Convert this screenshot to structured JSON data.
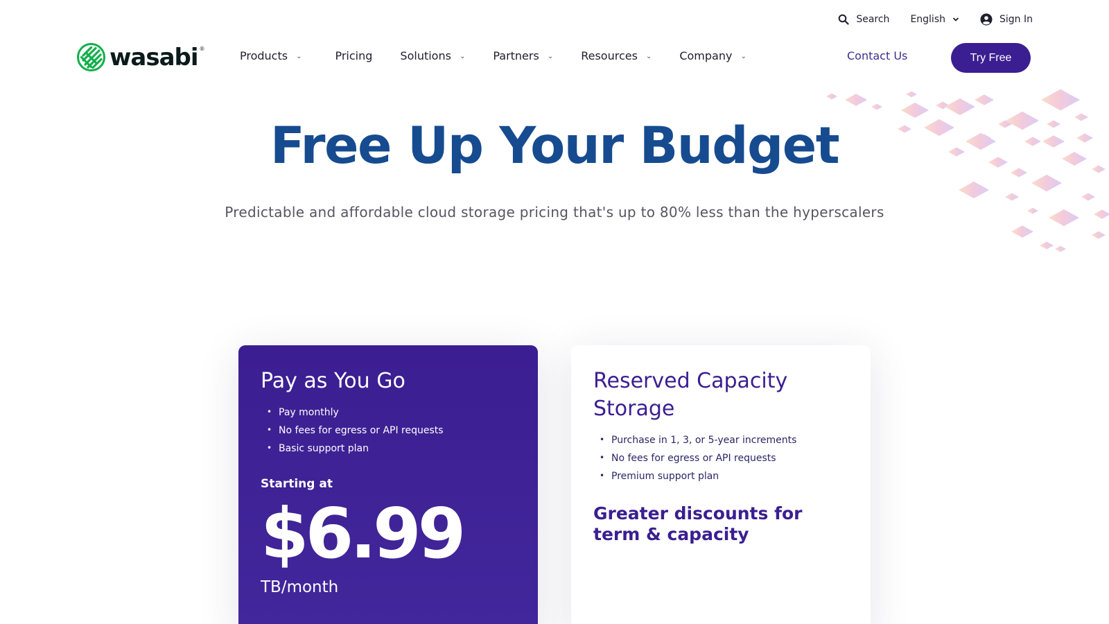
{
  "utility": {
    "search_label": "Search",
    "language_label": "English",
    "signin_label": "Sign In"
  },
  "brand": {
    "name": "wasabi",
    "reg_mark": "®",
    "colors": {
      "logo_green": "#12b04b",
      "accent_purple": "#3b1e91",
      "title_blue": "#164b8f"
    }
  },
  "nav": {
    "items": [
      {
        "label": "Products",
        "has_dropdown": true
      },
      {
        "label": "Pricing",
        "has_dropdown": false
      },
      {
        "label": "Solutions",
        "has_dropdown": true
      },
      {
        "label": "Partners",
        "has_dropdown": true
      },
      {
        "label": "Resources",
        "has_dropdown": true
      },
      {
        "label": "Company",
        "has_dropdown": true
      }
    ],
    "contact_label": "Contact Us",
    "cta_label": "Try Free"
  },
  "hero": {
    "title": "Free Up Your Budget",
    "subtitle": "Predictable and affordable cloud storage pricing that's up to 80% less than the hyperscalers"
  },
  "plans": {
    "payg": {
      "title": "Pay as You Go",
      "features": [
        "Pay monthly",
        "No fees for egress or API requests",
        "Basic support plan"
      ],
      "starting_label": "Starting at",
      "price": "$6.99",
      "unit": "TB/month"
    },
    "reserved": {
      "title": "Reserved Capacity Storage",
      "features": [
        "Purchase in 1, 3, or 5-year increments",
        "No fees for egress or API requests",
        "Premium support plan"
      ],
      "tagline": "Greater discounts for term & capacity"
    }
  },
  "icons": {
    "search": "search-icon",
    "language_chevron": "chevron-down-icon",
    "account": "account-circle-icon",
    "dropdown": "chevron-down-icon"
  }
}
